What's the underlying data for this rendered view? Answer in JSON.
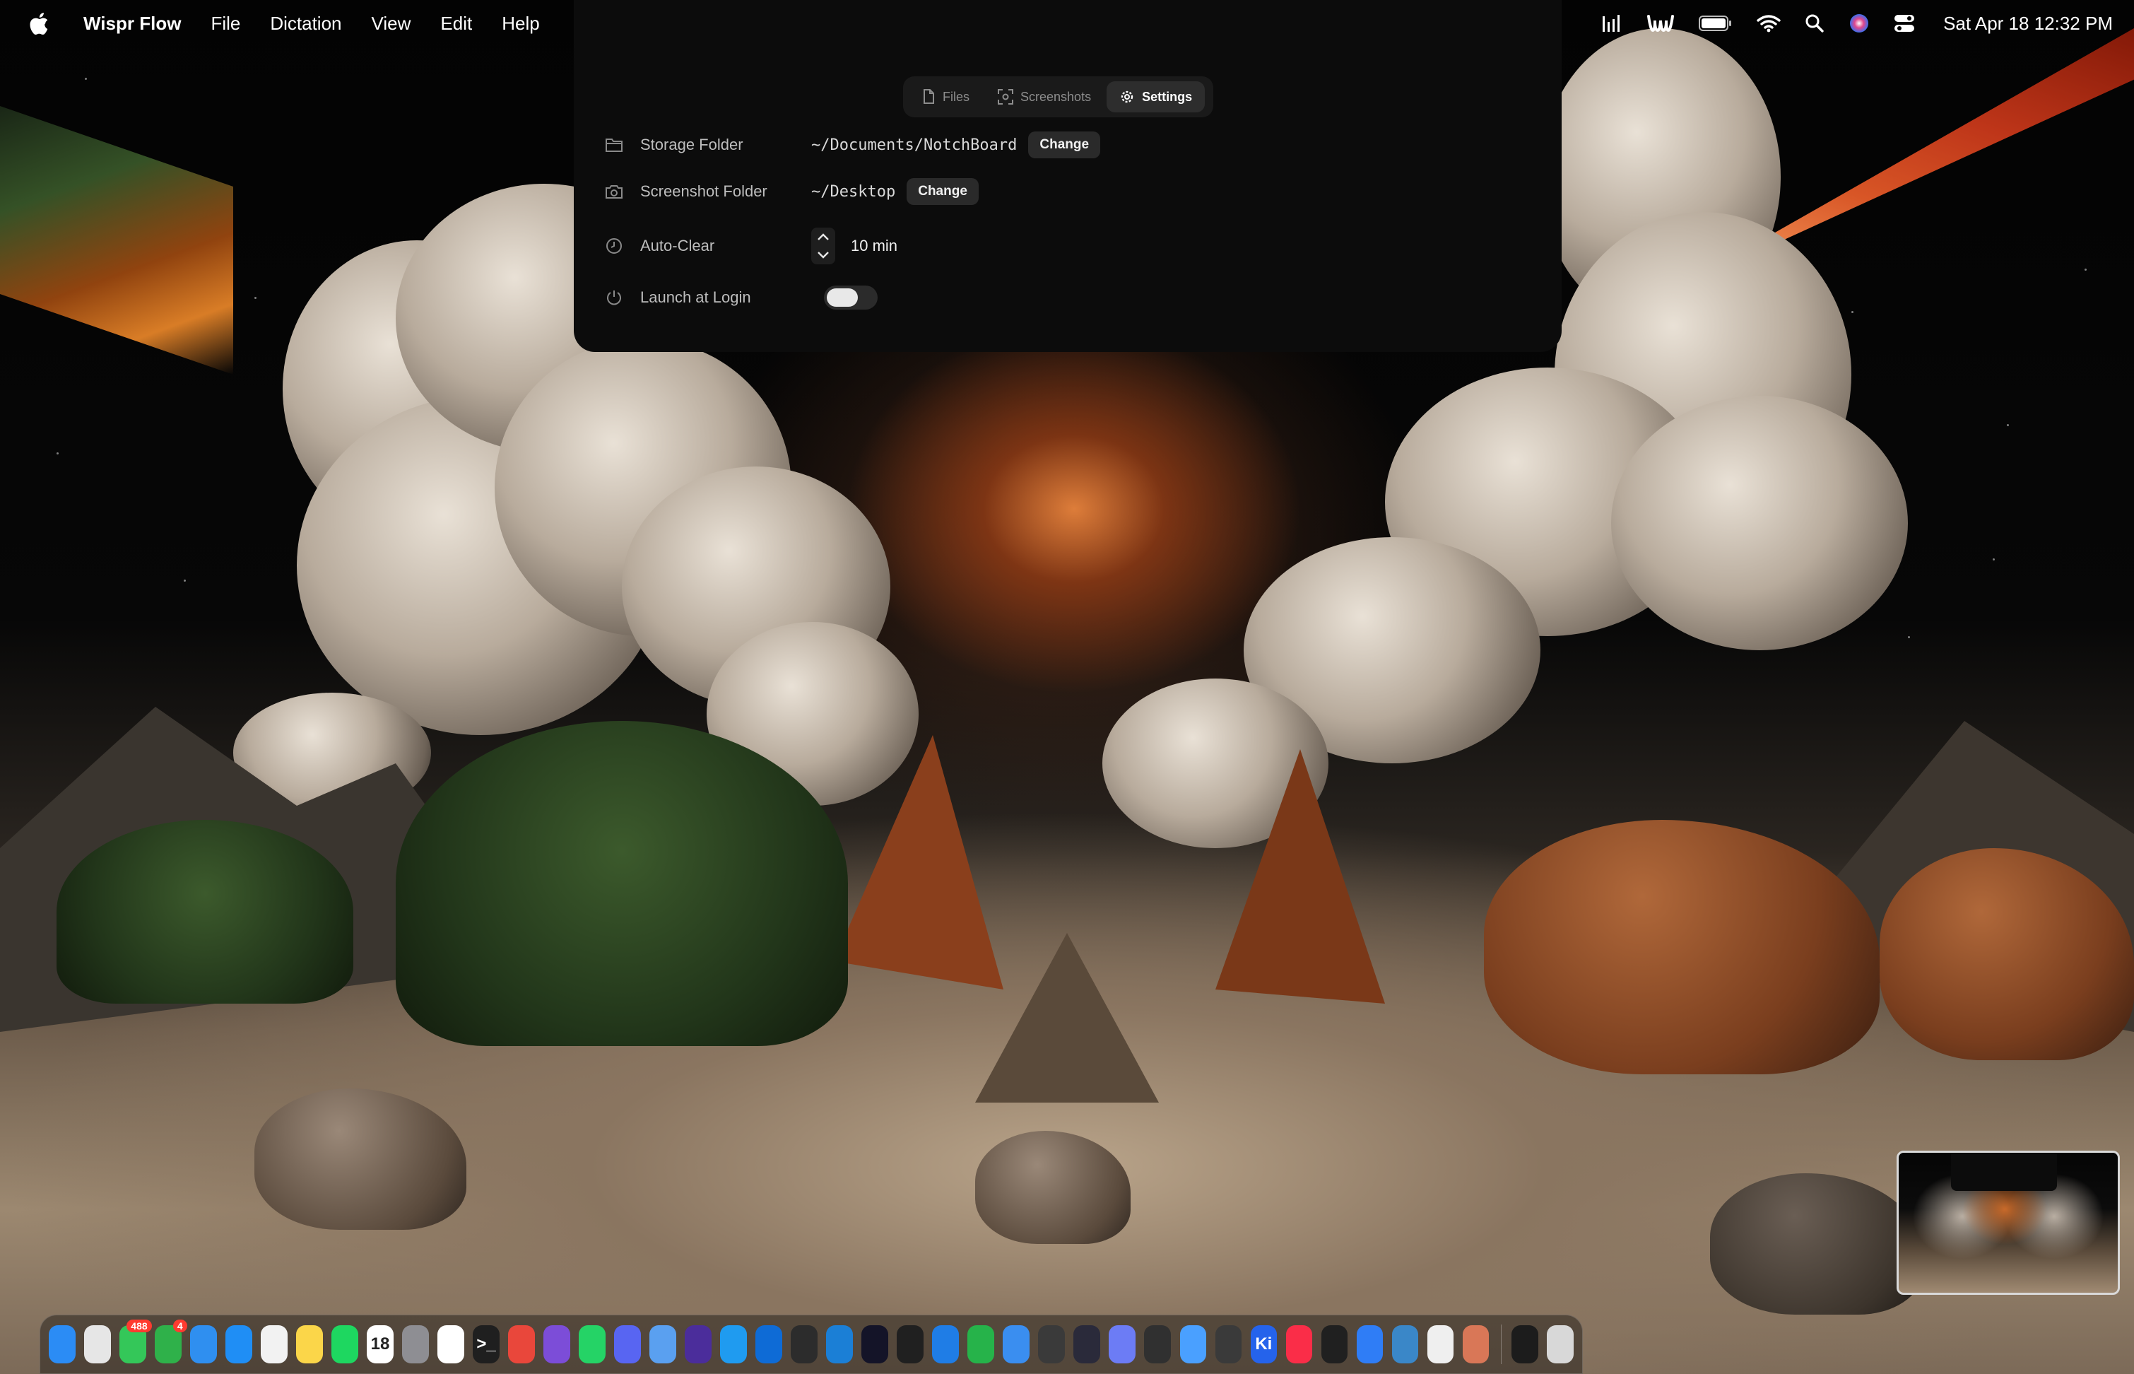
{
  "menubar": {
    "app_name": "Wispr Flow",
    "menus": [
      "File",
      "Dictation",
      "View",
      "Edit",
      "Help"
    ],
    "clock": "Sat Apr 18  12:32 PM",
    "status_icons": [
      "audio-levels-icon",
      "wispr-icon",
      "battery-icon",
      "wifi-icon",
      "search-icon",
      "siri-icon",
      "control-center-icon"
    ]
  },
  "panel": {
    "tabs": [
      {
        "label": "Files",
        "icon": "file-icon",
        "active": false
      },
      {
        "label": "Screenshots",
        "icon": "screenshot-icon",
        "active": false
      },
      {
        "label": "Settings",
        "icon": "gear-icon",
        "active": true
      }
    ],
    "settings": {
      "storage": {
        "label": "Storage Folder",
        "path": "~/Documents/NotchBoard",
        "button": "Change"
      },
      "screenshot": {
        "label": "Screenshot Folder",
        "path": "~/Desktop",
        "button": "Change"
      },
      "autoclear": {
        "label": "Auto-Clear",
        "value": "10 min"
      },
      "launch": {
        "label": "Launch at Login",
        "enabled": false
      }
    }
  },
  "dock": {
    "apps": [
      {
        "name": "finder",
        "color": "#2b8cf5"
      },
      {
        "name": "launchpad",
        "color": "#e6e6e6"
      },
      {
        "name": "messages",
        "color": "#34c759",
        "badge": "488"
      },
      {
        "name": "facetime",
        "color": "#2fb14a",
        "badge": "4"
      },
      {
        "name": "mail",
        "color": "#2f8ff0"
      },
      {
        "name": "safari",
        "color": "#1f8ef5"
      },
      {
        "name": "calendar-alt",
        "color": "#f2f2f2"
      },
      {
        "name": "notes",
        "color": "#fbd649"
      },
      {
        "name": "spotify",
        "color": "#1ed760"
      },
      {
        "name": "calendar",
        "color": "#ffffff",
        "text": "18"
      },
      {
        "name": "system-settings",
        "color": "#8e8e93"
      },
      {
        "name": "slack",
        "color": "#ffffff"
      },
      {
        "name": "terminal",
        "color": "#1f1f1f",
        "text": ">_"
      },
      {
        "name": "chrome",
        "color": "#e9473b"
      },
      {
        "name": "github",
        "color": "#7c4dd8"
      },
      {
        "name": "whatsapp",
        "color": "#25d366"
      },
      {
        "name": "discord",
        "color": "#5865f2"
      },
      {
        "name": "preview",
        "color": "#5aa0f0"
      },
      {
        "name": "crystal",
        "color": "#4b2d9b"
      },
      {
        "name": "loop",
        "color": "#1f9bf0"
      },
      {
        "name": "infinity",
        "color": "#0e6bd6"
      },
      {
        "name": "hub",
        "color": "#2c2c2c"
      },
      {
        "name": "vscode",
        "color": "#1b7fd6"
      },
      {
        "name": "artboard",
        "color": "#141428"
      },
      {
        "name": "cube",
        "color": "#202020"
      },
      {
        "name": "xcode",
        "color": "#1f7de6"
      },
      {
        "name": "numbers",
        "color": "#26b34a"
      },
      {
        "name": "files",
        "color": "#3a8ef0"
      },
      {
        "name": "stats",
        "color": "#3a3a3a"
      },
      {
        "name": "unity",
        "color": "#2a2a3a"
      },
      {
        "name": "gamepad",
        "color": "#6c7cf5"
      },
      {
        "name": "orb",
        "color": "#303030"
      },
      {
        "name": "simulator",
        "color": "#4aa0ff"
      },
      {
        "name": "hex",
        "color": "#3a3a3a"
      },
      {
        "name": "kit",
        "color": "#2563eb",
        "text": "Ki"
      },
      {
        "name": "music",
        "color": "#fa2d48"
      },
      {
        "name": "activity",
        "color": "#202020"
      },
      {
        "name": "search-q",
        "color": "#2f7df6"
      },
      {
        "name": "disk",
        "color": "#3a87c8"
      },
      {
        "name": "paper",
        "color": "#efefef"
      },
      {
        "name": "claude",
        "color": "#d97757"
      }
    ],
    "extras": [
      {
        "name": "window-thumb",
        "color": "#1c1c1c"
      },
      {
        "name": "trash",
        "color": "#d8d8d8"
      }
    ]
  }
}
